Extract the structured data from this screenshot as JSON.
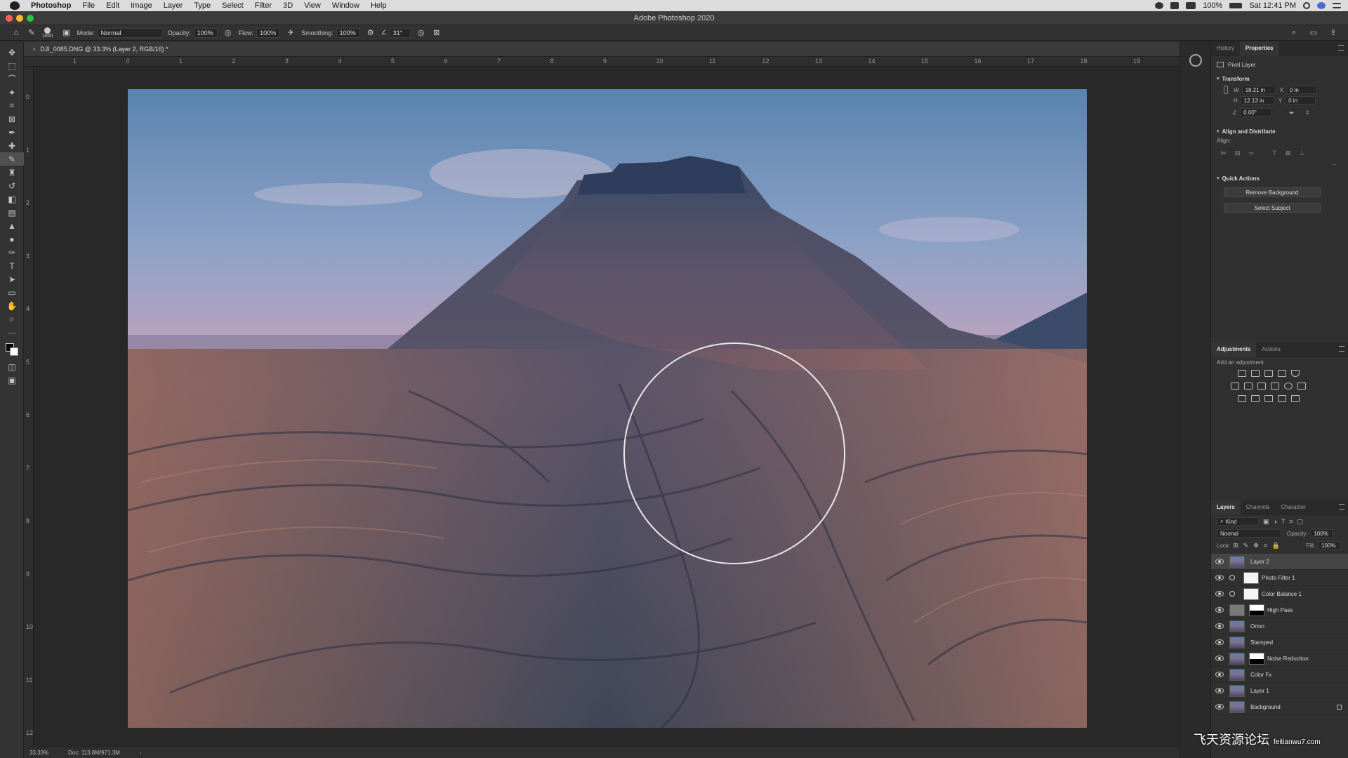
{
  "menubar": {
    "app": "Photoshop",
    "items": [
      "File",
      "Edit",
      "Image",
      "Layer",
      "Type",
      "Select",
      "Filter",
      "3D",
      "View",
      "Window",
      "Help"
    ],
    "battery": "100%",
    "clock": "Sat 12:41 PM"
  },
  "window": {
    "title": "Adobe Photoshop 2020"
  },
  "options": {
    "brush_size": "1600",
    "mode_label": "Mode:",
    "mode_value": "Normal",
    "opacity_label": "Opacity:",
    "opacity_value": "100%",
    "flow_label": "Flow:",
    "flow_value": "100%",
    "smoothing_label": "Smoothing:",
    "smoothing_value": "100%",
    "angle_value": "31°"
  },
  "document": {
    "tab_title": "DJI_0085.DNG @ 33.3% (Layer 2, RGB/16) *"
  },
  "rulers": {
    "h": [
      "1",
      "0",
      "1",
      "2",
      "3",
      "4",
      "5",
      "6",
      "7",
      "8",
      "9",
      "10",
      "11",
      "12",
      "13",
      "14",
      "15",
      "16",
      "17",
      "18",
      "19"
    ],
    "v": [
      "0",
      "1",
      "2",
      "3",
      "4",
      "5",
      "6",
      "7",
      "8",
      "9",
      "10",
      "11",
      "12"
    ]
  },
  "status": {
    "zoom": "33.33%",
    "doc": "Doc: 113.8M/971.3M"
  },
  "properties": {
    "tabs": [
      "History",
      "Properties"
    ],
    "active_tab": "Properties",
    "layer_type": "Pixel Layer",
    "transform_title": "Transform",
    "w_label": "W",
    "w_value": "18.21 in",
    "h_label": "H",
    "h_value": "12.13 in",
    "x_label": "X",
    "x_value": "0 in",
    "y_label": "Y",
    "y_value": "0 in",
    "angle_value": "0.00°",
    "align_title": "Align and Distribute",
    "align_label": "Align:",
    "quick_title": "Quick Actions",
    "remove_bg": "Remove Background",
    "select_subject": "Select Subject"
  },
  "adjustments": {
    "tabs": [
      "Adjustments",
      "Actions"
    ],
    "hint": "Add an adjustment"
  },
  "layers": {
    "tabs": [
      "Layers",
      "Channels",
      "Character"
    ],
    "kind_label": "Kind",
    "blend_mode": "Normal",
    "opacity_label": "Opacity:",
    "opacity_value": "100%",
    "lock_label": "Lock:",
    "fill_label": "Fill:",
    "fill_value": "100%",
    "items": [
      {
        "name": "Layer 2",
        "selected": true,
        "thumb": "photo"
      },
      {
        "name": "Photo Filter 1",
        "selected": false,
        "thumb": "adjust"
      },
      {
        "name": "Color Balance 1",
        "selected": false,
        "thumb": "adjust"
      },
      {
        "name": "High Pass",
        "selected": false,
        "thumb": "gray"
      },
      {
        "name": "Orton",
        "selected": false,
        "thumb": "photo"
      },
      {
        "name": "Stamped",
        "selected": false,
        "thumb": "photo"
      },
      {
        "name": "Noise Reduction",
        "selected": false,
        "thumb": "photo"
      },
      {
        "name": "Color Fx",
        "selected": false,
        "thumb": "photo"
      },
      {
        "name": "Layer 1",
        "selected": false,
        "thumb": "photo"
      },
      {
        "name": "Background",
        "selected": false,
        "thumb": "photo",
        "locked": true
      }
    ]
  },
  "watermark": {
    "text": "飞天资源论坛",
    "url": "feitianwu7.com"
  },
  "colors": {
    "accent": "#3d7fd6",
    "panel": "#303030",
    "canvas_bg": "#282828"
  }
}
